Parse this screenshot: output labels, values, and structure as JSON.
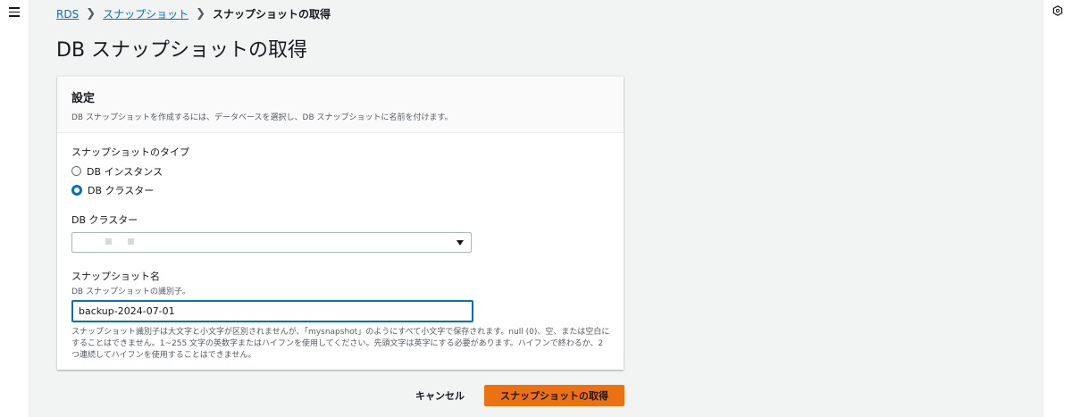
{
  "breadcrumb": {
    "root": "RDS",
    "parent": "スナップショット",
    "current": "スナップショットの取得"
  },
  "page": {
    "title": "DB スナップショットの取得"
  },
  "settings": {
    "title": "設定",
    "description": "DB スナップショットを作成するには、データベースを選択し、DB スナップショットに名前を付けます。",
    "snapshot_type_label": "スナップショットのタイプ",
    "options": [
      {
        "label": "DB インスタンス",
        "selected": false
      },
      {
        "label": "DB クラスター",
        "selected": true
      }
    ],
    "cluster_label": "DB クラスター",
    "snapshot_name_label": "スナップショット名",
    "snapshot_name_desc": "DB スナップショットの識別子。",
    "snapshot_name_value": "backup-2024-07-01",
    "constraint_text": "スナップショット識別子は大文字と小文字が区別されませんが、「mysnapshot」のようにすべて小文字で保存されます。null (0)、空、または空白にすることはできません。1~255 文字の英数字またはハイフンを使用してください。先頭文字は英字にする必要があります。ハイフンで終わるか、2 つ連続してハイフンを使用することはできません。"
  },
  "actions": {
    "cancel": "キャンセル",
    "submit": "スナップショットの取得"
  },
  "colors": {
    "link": "#0073bb",
    "primary": "#ec7211",
    "background": "#f2f3f3"
  },
  "icons": {
    "menu": "menu-icon",
    "info": "info-icon",
    "chevron": "chevron-right-icon",
    "caret": "caret-down-icon"
  }
}
